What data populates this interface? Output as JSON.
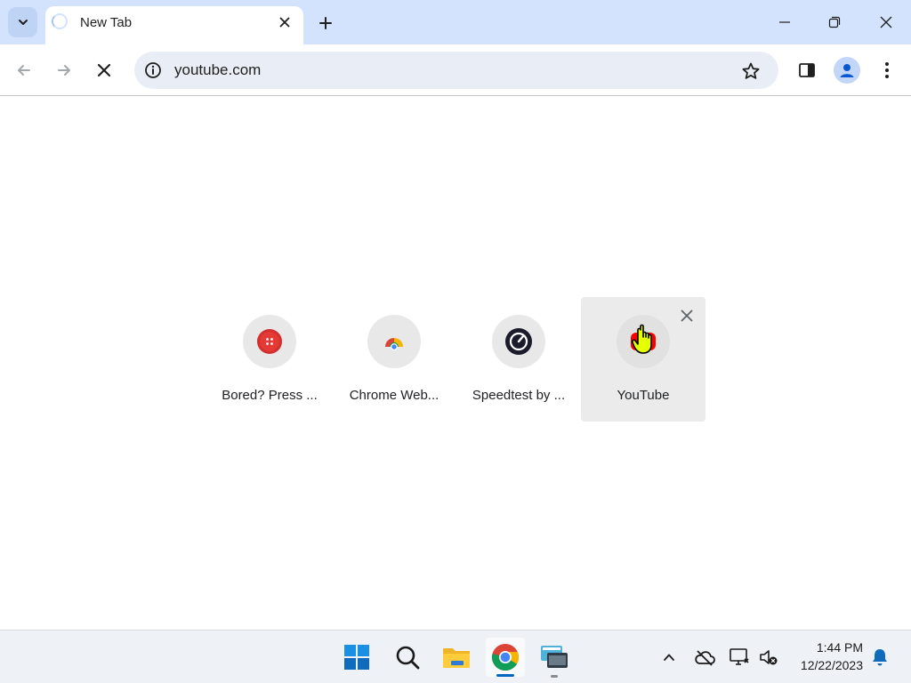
{
  "browser": {
    "tab": {
      "title": "New Tab"
    },
    "omnibox": {
      "value": "youtube.com"
    },
    "icons": {
      "tab_search": "chevron-down-icon",
      "tab_close": "close-icon",
      "new_tab": "plus-icon",
      "minimize": "minimize-icon",
      "restore": "restore-icon",
      "close_window": "close-icon",
      "back": "arrow-left-icon",
      "forward": "arrow-right-icon",
      "stop": "stop-icon",
      "site_info": "info-icon",
      "bookmark": "star-icon",
      "side_panel": "side-panel-icon",
      "profile": "person-icon",
      "menu": "kebab-menu-icon"
    },
    "colors": {
      "titlebar": "#d3e3fd",
      "omnibox": "#e9eef6",
      "accent": "#0b57d0"
    }
  },
  "shortcuts": [
    {
      "label": "Bored? Press ...",
      "icon": "red-button-icon",
      "color": "#d32f2f"
    },
    {
      "label": "Chrome Web...",
      "icon": "chrome-web-store-icon",
      "color": "#4285f4"
    },
    {
      "label": "Speedtest by ...",
      "icon": "speedometer-icon",
      "color": "#1b1b2b"
    },
    {
      "label": "YouTube",
      "icon": "youtube-icon",
      "color": "#ff0000",
      "hovered": true
    }
  ],
  "taskbar": {
    "apps": [
      "windows-start-icon",
      "search-icon",
      "file-explorer-icon",
      "chrome-icon",
      "remote-desktop-icon"
    ],
    "tray": [
      "chevron-up-icon",
      "cloud-offline-icon",
      "network-icon",
      "speaker-muted-icon",
      "notification-bell-icon"
    ],
    "clock": {
      "time": "1:44 PM",
      "date": "12/22/2023"
    }
  }
}
